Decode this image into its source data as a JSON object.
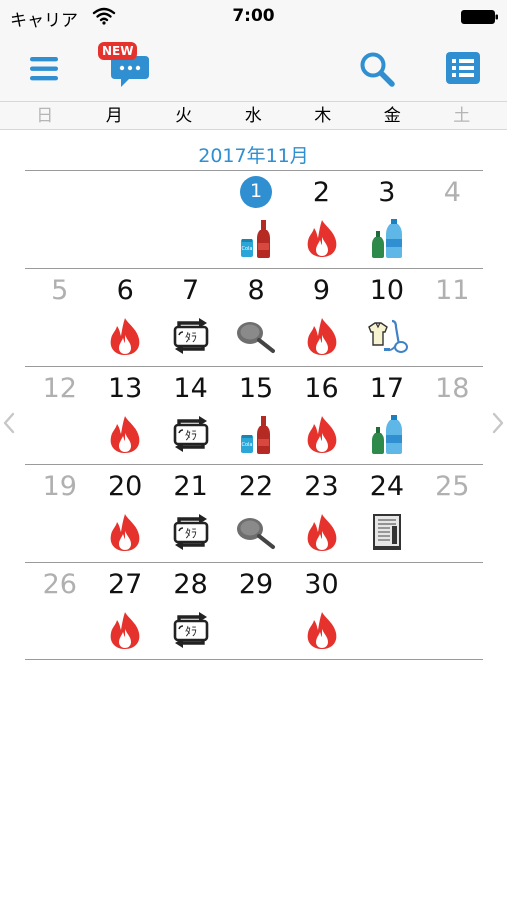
{
  "status": {
    "carrier": "キャリア",
    "time": "7:00"
  },
  "nav": {
    "news_badge": "NEW"
  },
  "weekdays": [
    "日",
    "月",
    "火",
    "水",
    "木",
    "金",
    "土"
  ],
  "month_title": "2017年11月",
  "weeks": [
    [
      {
        "day": ""
      },
      {
        "day": ""
      },
      {
        "day": ""
      },
      {
        "day": "1",
        "icon": "bottles-cans-icon",
        "today": true
      },
      {
        "day": "2",
        "icon": "burnable-fire-icon"
      },
      {
        "day": "3",
        "icon": "pet-bottles-icon"
      },
      {
        "day": "4",
        "weekend": true
      }
    ],
    [
      {
        "day": "5",
        "weekend": true
      },
      {
        "day": "6",
        "icon": "burnable-fire-icon"
      },
      {
        "day": "7",
        "icon": "recycle-resource-icon"
      },
      {
        "day": "8",
        "icon": "frying-pan-icon"
      },
      {
        "day": "9",
        "icon": "burnable-fire-icon"
      },
      {
        "day": "10",
        "icon": "clothes-vacuum-icon"
      },
      {
        "day": "11",
        "weekend": true
      }
    ],
    [
      {
        "day": "12",
        "weekend": true
      },
      {
        "day": "13",
        "icon": "burnable-fire-icon"
      },
      {
        "day": "14",
        "icon": "recycle-resource-icon"
      },
      {
        "day": "15",
        "icon": "bottles-cans-icon"
      },
      {
        "day": "16",
        "icon": "burnable-fire-icon"
      },
      {
        "day": "17",
        "icon": "pet-bottles-icon"
      },
      {
        "day": "18",
        "weekend": true
      }
    ],
    [
      {
        "day": "19",
        "weekend": true
      },
      {
        "day": "20",
        "icon": "burnable-fire-icon"
      },
      {
        "day": "21",
        "icon": "recycle-resource-icon"
      },
      {
        "day": "22",
        "icon": "frying-pan-icon"
      },
      {
        "day": "23",
        "icon": "burnable-fire-icon"
      },
      {
        "day": "24",
        "icon": "paper-bundle-icon"
      },
      {
        "day": "25",
        "weekend": true
      }
    ],
    [
      {
        "day": "26",
        "weekend": true
      },
      {
        "day": "27",
        "icon": "burnable-fire-icon"
      },
      {
        "day": "28",
        "icon": "recycle-resource-icon"
      },
      {
        "day": "29"
      },
      {
        "day": "30",
        "icon": "burnable-fire-icon"
      },
      {
        "day": ""
      },
      {
        "day": ""
      }
    ]
  ],
  "colors": {
    "accent": "#2f8fd1",
    "fire": "#e5322d",
    "weekend": "#b0b0b0",
    "grid": "#9a9a9a"
  }
}
